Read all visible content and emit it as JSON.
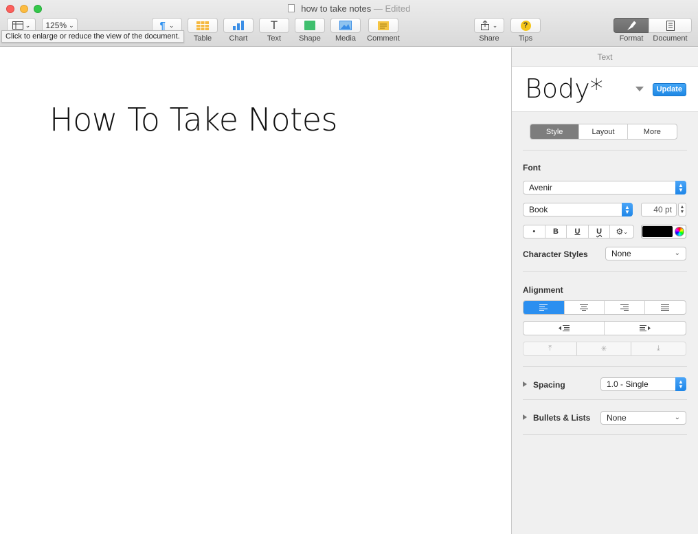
{
  "window": {
    "title": "how to take notes",
    "title_separator": "—",
    "edited": "Edited"
  },
  "toolbar": {
    "zoom": "125%",
    "items": [
      {
        "label": "Table",
        "icon": "table-icon"
      },
      {
        "label": "Chart",
        "icon": "chart-icon"
      },
      {
        "label": "Text",
        "icon": "text-icon"
      },
      {
        "label": "Shape",
        "icon": "shape-icon"
      },
      {
        "label": "Media",
        "icon": "media-icon"
      },
      {
        "label": "Comment",
        "icon": "comment-icon"
      }
    ],
    "share_label": "Share",
    "tips_label": "Tips",
    "format_label": "Format",
    "document_label": "Document",
    "tooltip": "Click to enlarge or reduce the view of the document."
  },
  "document": {
    "heading": "How To Take Notes"
  },
  "sidebar": {
    "header": "Text",
    "style_name": "Body*",
    "update_label": "Update",
    "tabs": [
      "Style",
      "Layout",
      "More"
    ],
    "font_section": "Font",
    "font_family": "Avenir",
    "font_typeface": "Book",
    "font_size": "40 pt",
    "format_buttons": [
      "•",
      "B",
      "U",
      "U"
    ],
    "char_styles_label": "Character Styles",
    "char_styles_value": "None",
    "alignment_section": "Alignment",
    "spacing_label": "Spacing",
    "spacing_value": "1.0 - Single",
    "bullets_label": "Bullets & Lists",
    "bullets_value": "None"
  },
  "colors": {
    "accent": "#2b8ff0",
    "text_color": "#000000"
  }
}
